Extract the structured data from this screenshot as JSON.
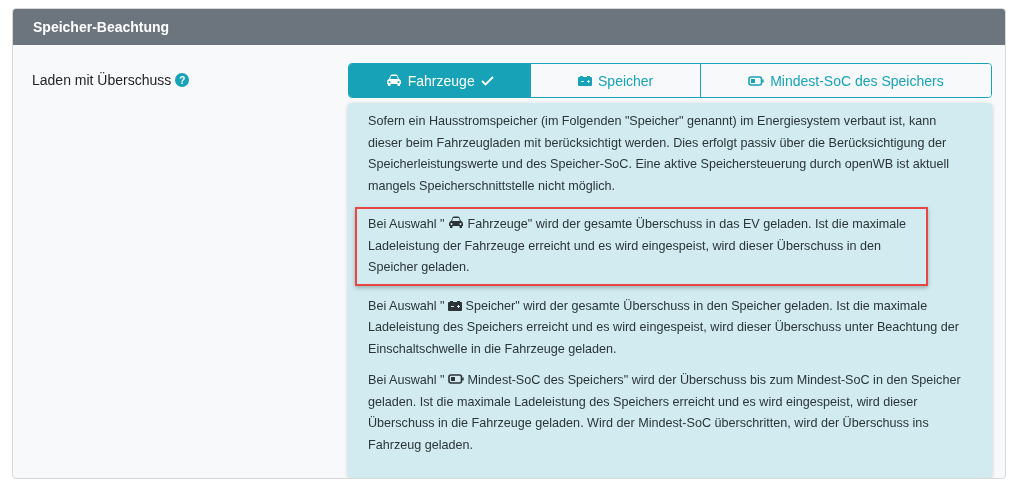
{
  "card": {
    "title": "Speicher-Beachtung"
  },
  "setting": {
    "label": "Laden mit Überschuss",
    "help": "?"
  },
  "tabs": [
    {
      "label": "Fahrzeuge",
      "kind": "car",
      "selected": true
    },
    {
      "label": "Speicher",
      "kind": "storage",
      "selected": false
    },
    {
      "label": "Mindest-SoC des Speichers",
      "kind": "battery",
      "selected": false
    }
  ],
  "info": {
    "paragraphs": [
      {
        "text": "Sofern ein Hausstromspeicher (im Folgenden \"Speicher\" genannt) im Energiesystem verbaut ist, kann dieser beim Fahrzeugladen mit berücksichtigt werden. Dies erfolgt passiv über die Berücksichtigung der Speicherleistungswerte und des Speicher-SoC. Eine aktive Speichersteuerung durch openWB ist aktuell mangels Speicherschnittstelle nicht möglich.",
        "highlighted": false
      },
      {
        "prefix": "Bei Auswahl \"",
        "kind": "car",
        "text": "Fahrzeuge\" wird der gesamte Überschuss in das EV geladen. Ist die maximale Ladeleistung der Fahrzeuge erreicht und es wird eingespeist, wird dieser Überschuss in den Speicher geladen.",
        "highlighted": true
      },
      {
        "prefix": "Bei Auswahl \"",
        "kind": "storage",
        "text": "Speicher\" wird der gesamte Überschuss in den Speicher geladen. Ist die maximale Ladeleistung des Speichers erreicht und es wird eingespeist, wird dieser Überschuss unter Beachtung der Einschaltschwelle in die Fahrzeuge geladen.",
        "highlighted": false
      },
      {
        "prefix": "Bei Auswahl \"",
        "kind": "battery",
        "text": "Mindest-SoC des Speichers\" wird der Überschuss bis zum Mindest-SoC in den Speicher geladen. Ist die maximale Ladeleistung des Speichers erreicht und es wird eingespeist, wird dieser Überschuss in die Fahrzeuge geladen. Wird der Mindest-SoC überschritten, wird der Überschuss ins Fahrzeug geladen.",
        "highlighted": false
      }
    ]
  }
}
